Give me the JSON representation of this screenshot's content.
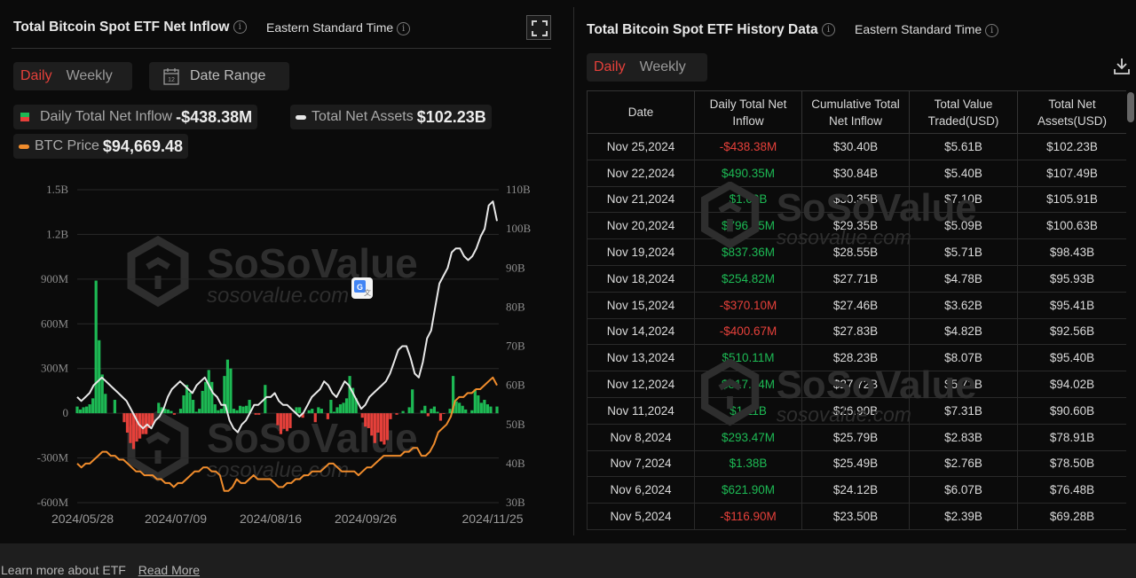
{
  "left_panel": {
    "title": "Total Bitcoin Spot ETF Net Inflow",
    "timezone": "Eastern Standard Time",
    "tabs": [
      {
        "label": "Daily",
        "active": true
      },
      {
        "label": "Weekly",
        "active": false
      }
    ],
    "date_range_label": "Date Range",
    "calendar_day": "12",
    "legend": {
      "inflow_label": "Daily Total Net Inflow",
      "inflow_value": "-$438.38M",
      "assets_label": "Total Net Assets",
      "assets_value": "$102.23B",
      "btc_label": "BTC Price",
      "btc_value": "$94,669.48"
    }
  },
  "right_panel": {
    "title": "Total Bitcoin Spot ETF History Data",
    "timezone": "Eastern Standard Time",
    "tabs": [
      {
        "label": "Daily",
        "active": true
      },
      {
        "label": "Weekly",
        "active": false
      }
    ],
    "columns": [
      "Date",
      "Daily Total Net Inflow",
      "Cumulative Total Net Inflow",
      "Total Value Traded(USD)",
      "Total Net Assets(USD)"
    ],
    "rows": [
      {
        "date": "Nov 25,2024",
        "inflow": "-$438.38M",
        "cumulative": "$30.40B",
        "traded": "$5.61B",
        "assets": "$102.23B",
        "sign": "neg"
      },
      {
        "date": "Nov 22,2024",
        "inflow": "$490.35M",
        "cumulative": "$30.84B",
        "traded": "$5.40B",
        "assets": "$107.49B",
        "sign": "pos"
      },
      {
        "date": "Nov 21,2024",
        "inflow": "$1.00B",
        "cumulative": "$30.35B",
        "traded": "$7.10B",
        "assets": "$105.91B",
        "sign": "pos"
      },
      {
        "date": "Nov 20,2024",
        "inflow": "$796.05M",
        "cumulative": "$29.35B",
        "traded": "$5.09B",
        "assets": "$100.63B",
        "sign": "pos"
      },
      {
        "date": "Nov 19,2024",
        "inflow": "$837.36M",
        "cumulative": "$28.55B",
        "traded": "$5.71B",
        "assets": "$98.43B",
        "sign": "pos"
      },
      {
        "date": "Nov 18,2024",
        "inflow": "$254.82M",
        "cumulative": "$27.71B",
        "traded": "$4.78B",
        "assets": "$95.93B",
        "sign": "pos"
      },
      {
        "date": "Nov 15,2024",
        "inflow": "-$370.10M",
        "cumulative": "$27.46B",
        "traded": "$3.62B",
        "assets": "$95.41B",
        "sign": "neg"
      },
      {
        "date": "Nov 14,2024",
        "inflow": "-$400.67M",
        "cumulative": "$27.83B",
        "traded": "$4.82B",
        "assets": "$92.56B",
        "sign": "neg"
      },
      {
        "date": "Nov 13,2024",
        "inflow": "$510.11M",
        "cumulative": "$28.23B",
        "traded": "$8.07B",
        "assets": "$95.40B",
        "sign": "pos"
      },
      {
        "date": "Nov 12,2024",
        "inflow": "$817.54M",
        "cumulative": "$27.72B",
        "traded": "$5.72B",
        "assets": "$94.02B",
        "sign": "pos"
      },
      {
        "date": "Nov 11,2024",
        "inflow": "$1.11B",
        "cumulative": "$26.90B",
        "traded": "$7.31B",
        "assets": "$90.60B",
        "sign": "pos"
      },
      {
        "date": "Nov 8,2024",
        "inflow": "$293.47M",
        "cumulative": "$25.79B",
        "traded": "$2.83B",
        "assets": "$78.91B",
        "sign": "pos"
      },
      {
        "date": "Nov 7,2024",
        "inflow": "$1.38B",
        "cumulative": "$25.49B",
        "traded": "$2.76B",
        "assets": "$78.50B",
        "sign": "pos"
      },
      {
        "date": "Nov 6,2024",
        "inflow": "$621.90M",
        "cumulative": "$24.12B",
        "traded": "$6.07B",
        "assets": "$76.48B",
        "sign": "pos"
      },
      {
        "date": "Nov 5,2024",
        "inflow": "-$116.90M",
        "cumulative": "$23.50B",
        "traded": "$2.39B",
        "assets": "$69.28B",
        "sign": "neg"
      }
    ]
  },
  "watermark": {
    "brand": "SoSo Value",
    "domain": "sosovalue.com"
  },
  "footer": {
    "text": "Learn more about ETF",
    "link": "Read More"
  },
  "colors": {
    "positive": "#1db954",
    "negative": "#e5403a",
    "assets_line": "#e8e8e8",
    "btc_line": "#f08c2c",
    "active_tab": "#e5403a"
  },
  "chart_data": {
    "type": "bar",
    "title": "Total Bitcoin Spot ETF Net Inflow",
    "x_tick_labels": [
      "2024/05/28",
      "2024/07/09",
      "2024/08/16",
      "2024/09/26",
      "2024/11/25"
    ],
    "x_range": [
      "2024/05/28",
      "2024/11/25"
    ],
    "left_axis": {
      "label": "Daily Total Net Inflow",
      "ticks": [
        "1.5B",
        "1.2B",
        "900M",
        "600M",
        "300M",
        "0",
        "-300M",
        "-600M"
      ],
      "ylim_millions": [
        -600,
        1500
      ]
    },
    "right_axis": {
      "label": "Total Net Assets / BTC Price",
      "ticks": [
        "110B",
        "100B",
        "90B",
        "80B",
        "70B",
        "60B",
        "50B",
        "40B",
        "30B"
      ],
      "ylim_billions": [
        30,
        110
      ]
    },
    "grid": true,
    "legend": [
      "Daily Total Net Inflow",
      "Total Net Assets",
      "BTC Price"
    ],
    "series": [
      {
        "name": "Daily Total Net Inflow",
        "kind": "bar",
        "unit": "USD millions",
        "values": [
          45,
          25,
          40,
          45,
          60,
          100,
          890,
          490,
          260,
          130,
          0,
          0,
          90,
          0,
          0,
          -60,
          -130,
          -200,
          -240,
          -190,
          -170,
          -140,
          -140,
          -100,
          -80,
          0,
          70,
          40,
          30,
          25,
          15,
          -10,
          0,
          30,
          120,
          190,
          140,
          90,
          10,
          30,
          150,
          210,
          290,
          210,
          60,
          20,
          30,
          250,
          360,
          300,
          30,
          20,
          50,
          45,
          50,
          90,
          0,
          -10,
          -10,
          0,
          190,
          0,
          0,
          0,
          -80,
          -140,
          -105,
          -120,
          -100,
          0,
          40,
          40,
          -30,
          0,
          20,
          30,
          -60,
          40,
          30,
          0,
          -40,
          90,
          10,
          40,
          60,
          70,
          100,
          250,
          170,
          100,
          0,
          -30,
          -90,
          -100,
          -150,
          -200,
          -130,
          -190,
          -210,
          -180,
          -40,
          0,
          -10,
          0,
          15,
          0,
          40,
          160,
          0,
          0,
          20,
          50,
          -20,
          30,
          45,
          10,
          -50,
          -5,
          0,
          30,
          250,
          80,
          70,
          50,
          25,
          0,
          20,
          160,
          120,
          70,
          90,
          60,
          45,
          0,
          45
        ],
        "note": "approximate daily values read from bars; last points follow table"
      },
      {
        "name": "Total Net Assets",
        "kind": "line",
        "unit": "USD billions",
        "values": [
          57,
          56,
          57,
          58,
          60,
          61,
          62,
          61,
          60,
          59,
          58,
          57,
          56,
          54,
          52,
          50,
          49,
          50,
          49,
          51,
          52,
          54,
          57,
          59,
          60,
          61,
          60,
          59,
          58,
          60,
          61,
          62,
          60,
          58,
          57,
          55,
          55,
          51,
          49,
          48,
          50,
          51,
          53,
          55,
          55,
          56,
          57,
          57,
          58,
          56,
          55,
          55,
          54,
          53,
          52,
          53,
          55,
          57,
          58,
          59,
          61,
          60,
          58,
          57,
          59,
          61,
          60,
          58,
          56,
          54,
          55,
          57,
          58,
          59,
          60,
          61,
          63,
          66,
          69,
          70,
          70,
          67,
          63,
          62,
          66,
          72,
          74,
          80,
          86,
          88,
          90,
          94,
          95,
          95,
          93,
          92,
          93,
          95,
          98,
          100,
          106,
          107,
          102
        ]
      },
      {
        "name": "BTC Price",
        "kind": "line",
        "unit": "USD (plotted on right axis scale)",
        "values": [
          40,
          39,
          40,
          40,
          41,
          42,
          43,
          43,
          42,
          42,
          41,
          41,
          40,
          39,
          38,
          38,
          37,
          37,
          37,
          36,
          36,
          35,
          35,
          34,
          35,
          35,
          36,
          37,
          38,
          38,
          39,
          39,
          38,
          38,
          37,
          33,
          33,
          34,
          36,
          35,
          35,
          36,
          37,
          36,
          36,
          36,
          36,
          35,
          34,
          34,
          35,
          35,
          36,
          36,
          37,
          37,
          38,
          38,
          38,
          39,
          40,
          40,
          39,
          38,
          38,
          38,
          38,
          37,
          38,
          39,
          39,
          40,
          41,
          42,
          42,
          42,
          42,
          42,
          43,
          43,
          44,
          44,
          42,
          42,
          43,
          45,
          48,
          49,
          50,
          52,
          56,
          57,
          57,
          58,
          58,
          59,
          59,
          60,
          61,
          62,
          60
        ]
      }
    ]
  }
}
